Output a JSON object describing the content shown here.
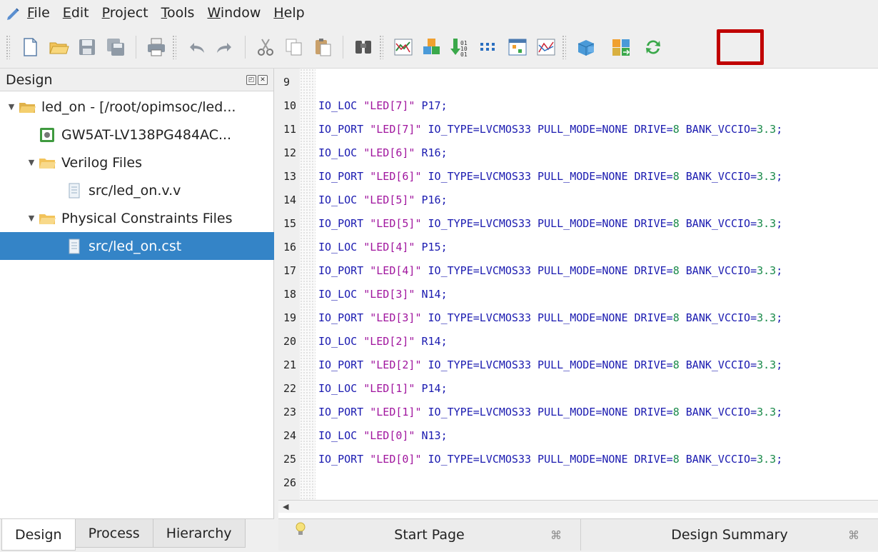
{
  "menu": {
    "items": [
      {
        "label": "File",
        "u": "F",
        "rest": "ile"
      },
      {
        "label": "Edit",
        "u": "E",
        "rest": "dit"
      },
      {
        "label": "Project",
        "u": "P",
        "rest": "roject"
      },
      {
        "label": "Tools",
        "u": "T",
        "rest": "ools"
      },
      {
        "label": "Window",
        "u": "W",
        "rest": "indow"
      },
      {
        "label": "Help",
        "u": "H",
        "rest": "elp"
      }
    ]
  },
  "toolbar": {
    "icons": [
      "new-file-icon",
      "open-folder-icon",
      "save-icon",
      "save-all-icon",
      "print-icon",
      "undo-icon",
      "redo-icon",
      "cut-icon",
      "copy-icon",
      "paste-icon",
      "find-icon",
      "synthesize-icon",
      "place-route-icon",
      "program-device-icon",
      "floorplanner-icon",
      "timing-constraints-icon",
      "timing-analyzer-icon",
      "ip-core-icon",
      "floor-planner-highlighted-icon",
      "refresh-icon"
    ],
    "highlighted_icon": "floor-planner-highlighted-icon"
  },
  "design_panel": {
    "title": "Design",
    "tree": [
      {
        "label": "led_on - [/root/opimsoc/led...",
        "icon": "project-folder-icon",
        "level": 0,
        "expanded": true
      },
      {
        "label": "GW5AT-LV138PG484AC...",
        "icon": "chip-icon",
        "level": 1
      },
      {
        "label": "Verilog Files",
        "icon": "folder-icon",
        "level": 1,
        "expanded": true
      },
      {
        "label": "src/led_on.v.v",
        "icon": "file-icon",
        "level": 2
      },
      {
        "label": "Physical Constraints Files",
        "icon": "folder-icon",
        "level": 1,
        "expanded": true
      },
      {
        "label": "src/led_on.cst",
        "icon": "file-icon",
        "level": 2,
        "selected": true
      }
    ],
    "tabs": [
      "Design",
      "Process",
      "Hierarchy"
    ],
    "active_tab": "Design"
  },
  "editor": {
    "lines": [
      {
        "n": "9",
        "text": ""
      },
      {
        "n": "10",
        "text": "IO_LOC \"LED[7]\" P17;"
      },
      {
        "n": "11",
        "text": "IO_PORT \"LED[7]\" IO_TYPE=LVCMOS33 PULL_MODE=NONE DRIVE=8 BANK_VCCIO=3.3;"
      },
      {
        "n": "12",
        "text": "IO_LOC \"LED[6]\" R16;"
      },
      {
        "n": "13",
        "text": "IO_PORT \"LED[6]\" IO_TYPE=LVCMOS33 PULL_MODE=NONE DRIVE=8 BANK_VCCIO=3.3;"
      },
      {
        "n": "14",
        "text": "IO_LOC \"LED[5]\" P16;"
      },
      {
        "n": "15",
        "text": "IO_PORT \"LED[5]\" IO_TYPE=LVCMOS33 PULL_MODE=NONE DRIVE=8 BANK_VCCIO=3.3;"
      },
      {
        "n": "16",
        "text": "IO_LOC \"LED[4]\" P15;"
      },
      {
        "n": "17",
        "text": "IO_PORT \"LED[4]\" IO_TYPE=LVCMOS33 PULL_MODE=NONE DRIVE=8 BANK_VCCIO=3.3;"
      },
      {
        "n": "18",
        "text": "IO_LOC \"LED[3]\" N14;"
      },
      {
        "n": "19",
        "text": "IO_PORT \"LED[3]\" IO_TYPE=LVCMOS33 PULL_MODE=NONE DRIVE=8 BANK_VCCIO=3.3;"
      },
      {
        "n": "20",
        "text": "IO_LOC \"LED[2]\" R14;"
      },
      {
        "n": "21",
        "text": "IO_PORT \"LED[2]\" IO_TYPE=LVCMOS33 PULL_MODE=NONE DRIVE=8 BANK_VCCIO=3.3;"
      },
      {
        "n": "22",
        "text": "IO_LOC \"LED[1]\" P14;"
      },
      {
        "n": "23",
        "text": "IO_PORT \"LED[1]\" IO_TYPE=LVCMOS33 PULL_MODE=NONE DRIVE=8 BANK_VCCIO=3.3;"
      },
      {
        "n": "24",
        "text": "IO_LOC \"LED[0]\" N13;"
      },
      {
        "n": "25",
        "text": "IO_PORT \"LED[0]\" IO_TYPE=LVCMOS33 PULL_MODE=NONE DRIVE=8 BANK_VCCIO=3.3;"
      },
      {
        "n": "26",
        "text": ""
      }
    ],
    "tabs": [
      {
        "label": "Start Page",
        "close": "⌘"
      },
      {
        "label": "Design Summary",
        "close": "⌘"
      }
    ]
  },
  "colors": {
    "keyword": "#1a1ab0",
    "string": "#a0159e",
    "number": "#1a8a4a",
    "selection": "#3484c7",
    "highlight_box": "#c00000"
  }
}
